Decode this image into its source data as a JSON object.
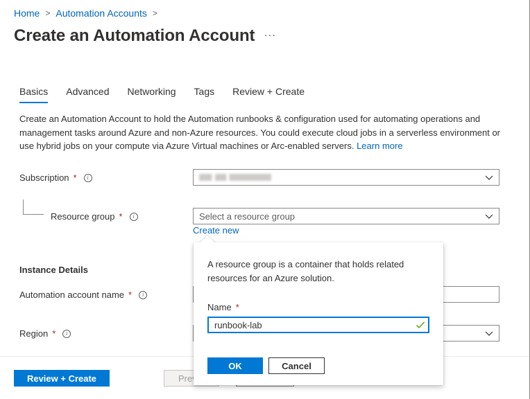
{
  "breadcrumb": {
    "items": [
      "Home",
      "Automation Accounts"
    ],
    "separator": ">"
  },
  "page": {
    "title": "Create an Automation Account",
    "more_label": "···"
  },
  "tabs": [
    {
      "label": "Basics",
      "active": true
    },
    {
      "label": "Advanced",
      "active": false
    },
    {
      "label": "Networking",
      "active": false
    },
    {
      "label": "Tags",
      "active": false
    },
    {
      "label": "Review + Create",
      "active": false
    }
  ],
  "description": {
    "text": "Create an Automation Account to hold the Automation runbooks & configuration used for automating operations and management tasks around Azure and non-Azure resources. You could execute cloud jobs in a serverless environment or use hybrid jobs on your compute via Azure Virtual machines or Arc-enabled servers.",
    "link_label": "Learn more"
  },
  "form": {
    "required_marker": "*",
    "info_glyph": "i",
    "subscription": {
      "label": "Subscription",
      "value_obscured": true
    },
    "resource_group": {
      "label": "Resource group",
      "placeholder": "Select a resource group",
      "create_new_label": "Create new"
    },
    "instance_details_title": "Instance Details",
    "account_name": {
      "label": "Automation account name",
      "value": ""
    },
    "region": {
      "label": "Region",
      "value": ""
    }
  },
  "callout": {
    "text": "A resource group is a container that holds related resources for an Azure solution.",
    "name_label": "Name",
    "name_value": "runbook-lab",
    "ok_label": "OK",
    "cancel_label": "Cancel"
  },
  "footer": {
    "review_create_label": "Review + Create",
    "previous_label": "Previous",
    "next_label": ""
  },
  "colors": {
    "accent": "#0078d4",
    "link": "#0067b8",
    "required": "#a4262c",
    "valid": "#57a300"
  }
}
